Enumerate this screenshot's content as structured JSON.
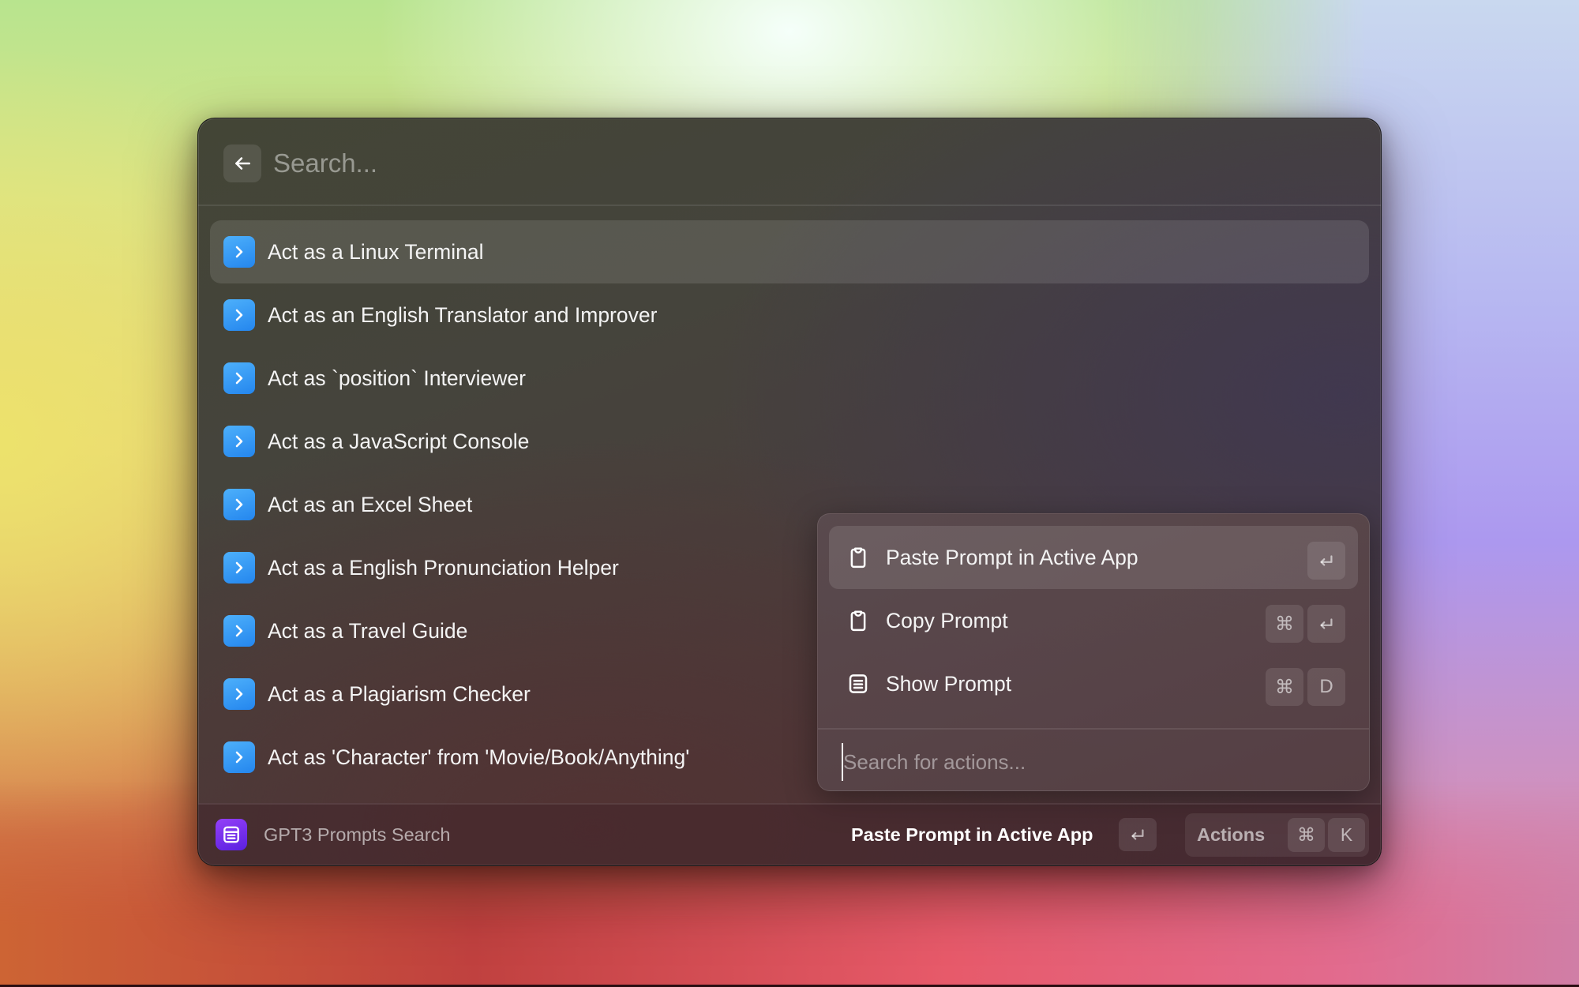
{
  "search": {
    "placeholder": "Search...",
    "value": "",
    "back_icon": "arrow-left-icon"
  },
  "list": {
    "selected_index": 0,
    "item_icon": "chevron-right-icon",
    "items": [
      {
        "label": "Act as a Linux Terminal"
      },
      {
        "label": "Act as an English Translator and Improver"
      },
      {
        "label": "Act as `position` Interviewer"
      },
      {
        "label": "Act as a JavaScript Console"
      },
      {
        "label": "Act as an Excel Sheet"
      },
      {
        "label": "Act as a English Pronunciation Helper"
      },
      {
        "label": "Act as a Travel Guide"
      },
      {
        "label": "Act as a Plagiarism Checker"
      },
      {
        "label": "Act as 'Character' from 'Movie/Book/Anything'"
      }
    ]
  },
  "actions_panel": {
    "items": [
      {
        "label": "Paste Prompt in Active App",
        "icon": "clipboard-icon",
        "keys": [
          "↵"
        ],
        "selected": true
      },
      {
        "label": "Copy Prompt",
        "icon": "clipboard-icon",
        "keys": [
          "⌘",
          "↵"
        ],
        "selected": false
      },
      {
        "label": "Show Prompt",
        "icon": "document-icon",
        "keys": [
          "⌘",
          "D"
        ],
        "selected": false
      }
    ],
    "search_placeholder": "Search for actions...",
    "search_value": ""
  },
  "footer": {
    "app_name": "GPT3 Prompts Search",
    "app_icon": "document-list-icon",
    "primary_action": "Paste Prompt in Active App",
    "primary_key": "↵",
    "actions_label": "Actions",
    "actions_keys": [
      "⌘",
      "K"
    ]
  },
  "colors": {
    "item_icon_blue": "#2f95f2",
    "app_icon_purple": "#7a30ee",
    "text_primary": "#f4f4f4"
  }
}
